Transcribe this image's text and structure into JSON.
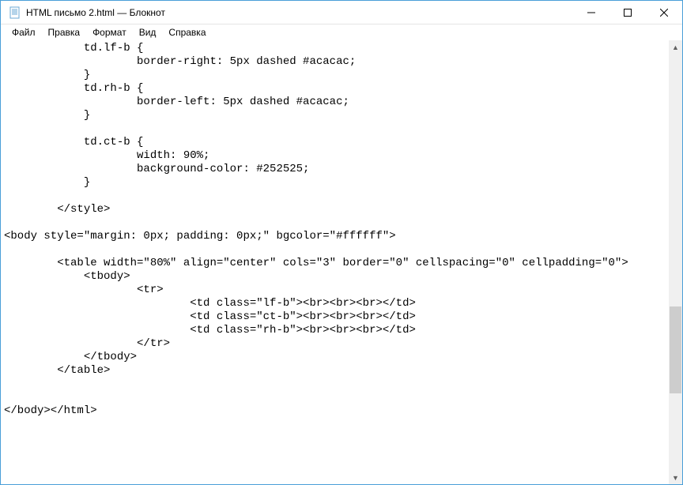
{
  "titlebar": {
    "title": "HTML письмо 2.html — Блокнот"
  },
  "menubar": {
    "file": "Файл",
    "edit": "Правка",
    "format": "Формат",
    "view": "Вид",
    "help": "Справка"
  },
  "editor": {
    "content": "            td.lf-b {\n                    border-right: 5px dashed #acacac;\n            }\n            td.rh-b {\n                    border-left: 5px dashed #acacac;\n            }\n\n            td.ct-b {\n                    width: 90%;\n                    background-color: #252525;\n            }\n\n        </style>\n\n<body style=\"margin: 0px; padding: 0px;\" bgcolor=\"#ffffff\">\n\n        <table width=\"80%\" align=\"center\" cols=\"3\" border=\"0\" cellspacing=\"0\" cellpadding=\"0\">\n            <tbody>\n                    <tr>\n                            <td class=\"lf-b\"><br><br><br></td>\n                            <td class=\"ct-b\"><br><br><br></td>\n                            <td class=\"rh-b\"><br><br><br></td>\n                    </tr>\n            </tbody>\n        </table>\n\n\n</body></html>"
  }
}
